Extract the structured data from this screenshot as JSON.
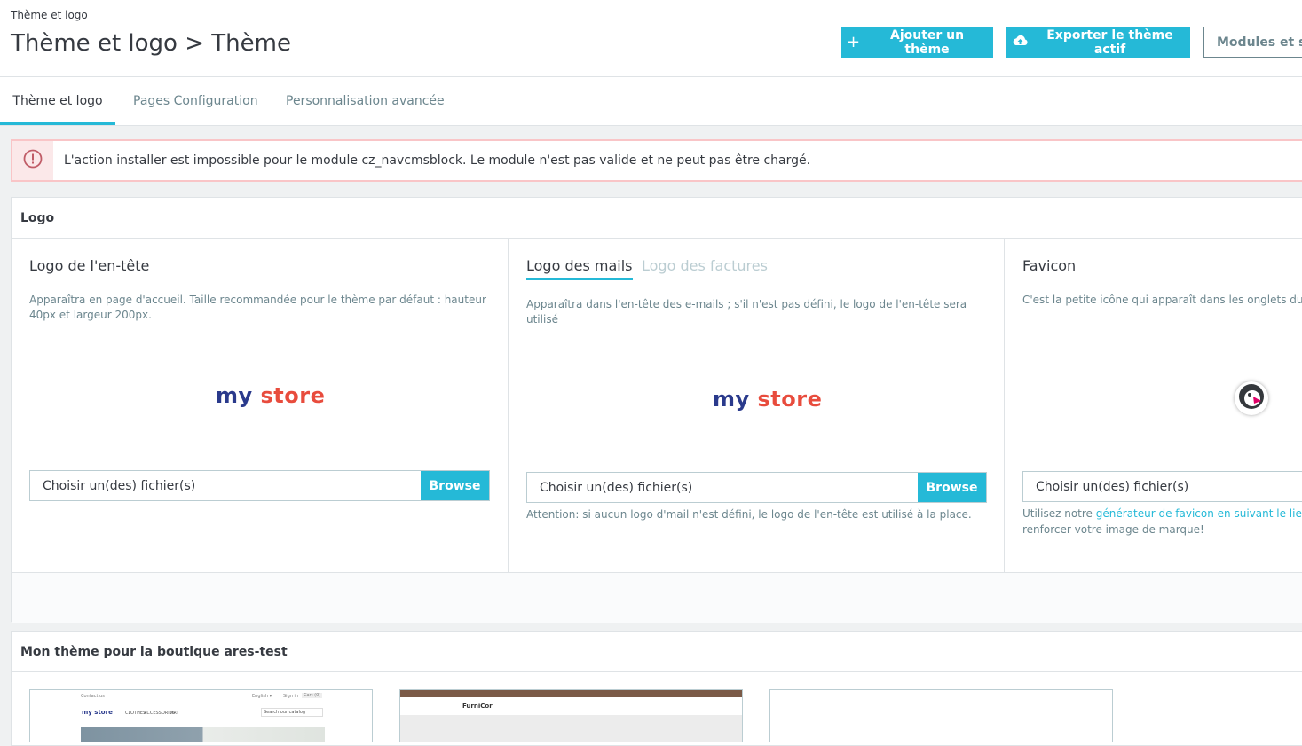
{
  "header": {
    "breadcrumb": "Thème et logo",
    "title": "Thème et logo > Thème",
    "add_theme_label": "Ajouter un thème",
    "export_theme_label": "Exporter le thème actif",
    "modules_label": "Modules et ser"
  },
  "tabs": [
    "Thème et logo",
    "Pages Configuration",
    "Personnalisation avancée"
  ],
  "alert": {
    "message": "L'action installer est impossible pour le module cz_navcmsblock. Le module n'est pas valide et ne peut pas être chargé."
  },
  "logo_card": {
    "title": "Logo",
    "header_logo": {
      "title": "Logo de l'en-tête",
      "description": "Apparaîtra en page d'accueil. Taille recommandée pour le thème par défaut : hauteur 40px et largeur 200px.",
      "logo_text_a": "my",
      "logo_text_b": "store",
      "file_placeholder": "Choisir un(des) fichier(s)",
      "browse_label": "Browse"
    },
    "mail_logo": {
      "tab_active": "Logo des mails",
      "tab_inactive": "Logo des factures",
      "description": "Apparaîtra dans l'en-tête des e-mails ; s'il n'est pas défini, le logo de l'en-tête sera utilisé",
      "logo_text_a": "my",
      "logo_text_b": "store",
      "file_placeholder": "Choisir un(des) fichier(s)",
      "browse_label": "Browse",
      "note": "Attention: si aucun logo d'mail n'est défini, le logo de l'en-tête est utilisé à la place."
    },
    "favicon": {
      "title": "Favicon",
      "description": "C'est la petite icône qui apparaît dans les onglets du naviga",
      "file_placeholder": "Choisir un(des) fichier(s)",
      "note_prefix": "Utilisez notre ",
      "note_link": "générateur de favicon en suivant le lien Pre",
      "note_suffix": "renforcer votre image de marque!"
    }
  },
  "theme_card": {
    "title": "Mon thème pour la boutique ares-test",
    "thumb1": {
      "contact": "Contact us",
      "lang": "English ▾",
      "signin": "Sign in",
      "cart": "Cart (0)",
      "logo": "my store",
      "menu": [
        "CLOTHES",
        "ACCESSORIES",
        "ART"
      ],
      "search": "Search our catalog"
    },
    "thumb2": {
      "brand": "FurniCor"
    }
  },
  "colors": {
    "primary": "#25b9d7",
    "danger": "#c05c67",
    "text": "#363a41",
    "muted": "#6c868e"
  }
}
